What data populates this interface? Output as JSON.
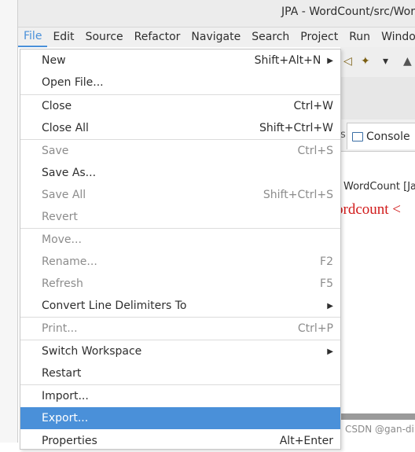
{
  "window": {
    "title": "JPA - WordCount/src/Wor"
  },
  "menubar": {
    "items": [
      "File",
      "Edit",
      "Source",
      "Refactor",
      "Navigate",
      "Search",
      "Project",
      "Run",
      "Window"
    ]
  },
  "file_menu": {
    "items": [
      {
        "label": "New",
        "accel": "Shift+Alt+N",
        "submenu": true,
        "disabled": false
      },
      {
        "label": "Open File...",
        "accel": "",
        "submenu": false,
        "disabled": false
      },
      {
        "label": "Close",
        "accel": "Ctrl+W",
        "submenu": false,
        "disabled": false
      },
      {
        "label": "Close All",
        "accel": "Shift+Ctrl+W",
        "submenu": false,
        "disabled": false
      },
      {
        "label": "Save",
        "accel": "Ctrl+S",
        "submenu": false,
        "disabled": true
      },
      {
        "label": "Save As...",
        "accel": "",
        "submenu": false,
        "disabled": false
      },
      {
        "label": "Save All",
        "accel": "Shift+Ctrl+S",
        "submenu": false,
        "disabled": true
      },
      {
        "label": "Revert",
        "accel": "",
        "submenu": false,
        "disabled": true
      },
      {
        "label": "Move...",
        "accel": "",
        "submenu": false,
        "disabled": true
      },
      {
        "label": "Rename...",
        "accel": "F2",
        "submenu": false,
        "disabled": true
      },
      {
        "label": "Refresh",
        "accel": "F5",
        "submenu": false,
        "disabled": true
      },
      {
        "label": "Convert Line Delimiters To",
        "accel": "",
        "submenu": true,
        "disabled": false
      },
      {
        "label": "Print...",
        "accel": "Ctrl+P",
        "submenu": false,
        "disabled": true
      },
      {
        "label": "Switch Workspace",
        "accel": "",
        "submenu": true,
        "disabled": false
      },
      {
        "label": "Restart",
        "accel": "",
        "submenu": false,
        "disabled": false
      },
      {
        "label": "Import...",
        "accel": "",
        "submenu": false,
        "disabled": false
      },
      {
        "label": "Export...",
        "accel": "",
        "submenu": false,
        "disabled": false,
        "selected": true
      },
      {
        "label": "Properties",
        "accel": "Alt+Enter",
        "submenu": false,
        "disabled": false
      }
    ]
  },
  "console": {
    "tab_prev": "s",
    "tab_label": "Console",
    "line1": "WordCount [Ja",
    "line2": "ordcount <"
  },
  "watermark": "CSDN @gan-di",
  "colors": {
    "selection": "#4a90d9",
    "error_text": "#d11a1a",
    "disabled_text": "#8c8c8c"
  }
}
